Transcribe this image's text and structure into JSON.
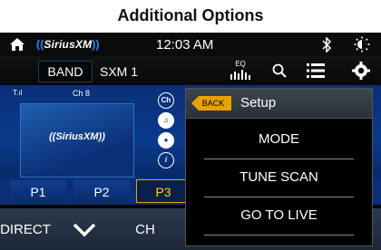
{
  "caption": "Additional Options",
  "status_bar": {
    "logo": "SiriusXM",
    "time": "12:03 AM"
  },
  "toolbar": {
    "band_label": "BAND",
    "station": "SXM 1",
    "eq_label": "EQ"
  },
  "content": {
    "channel_label": "Ch 8",
    "album_logo": "SiriusXM",
    "signal_label": "T.ıl",
    "info_icons": [
      "Ch",
      "note",
      "person",
      "i"
    ]
  },
  "presets": [
    "P1",
    "P2",
    "P3"
  ],
  "active_preset": "P3",
  "bottom_bar": {
    "direct_label": "DIRECT",
    "ch_label": "CH"
  },
  "setup_menu": {
    "back_label": "BACK",
    "title": "Setup",
    "items": [
      "MODE",
      "TUNE SCAN",
      "GO TO LIVE"
    ]
  },
  "colors": {
    "accent_yellow": "#ffd60a",
    "back_orange": "#e8a200",
    "content_blue": "#0a3a8c",
    "sxm_blue": "#1e90ff"
  }
}
